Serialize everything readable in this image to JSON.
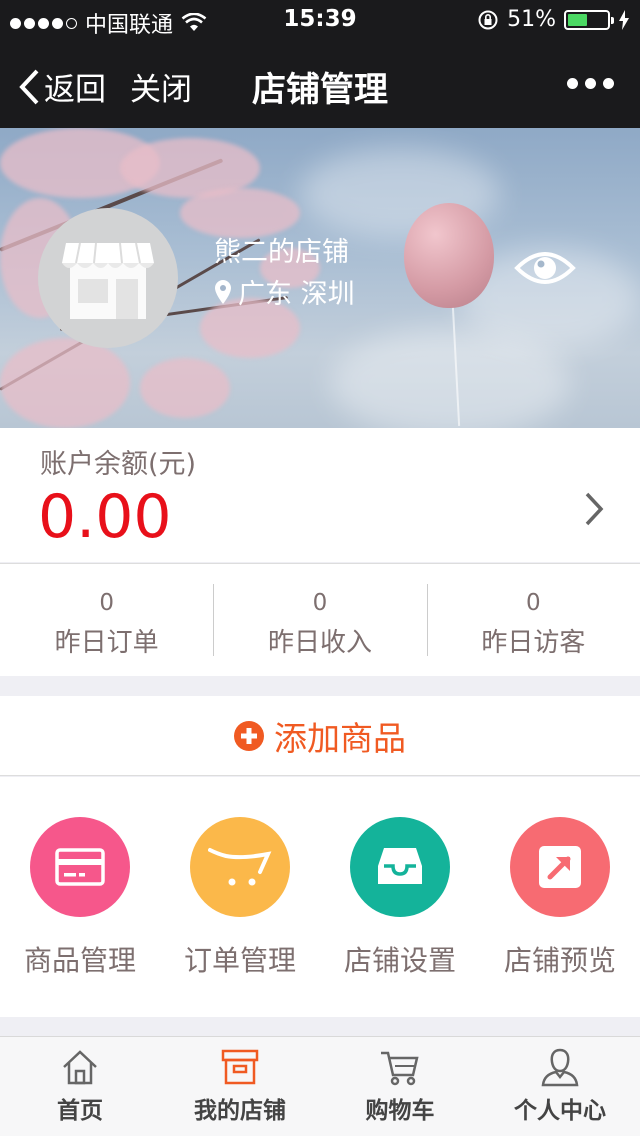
{
  "status_bar": {
    "carrier": "中国联通",
    "time": "15:39",
    "battery_percent": "51%",
    "battery_level": 0.51
  },
  "nav": {
    "back_label": "返回",
    "close_label": "关闭",
    "title": "店铺管理"
  },
  "shop": {
    "name": "熊二的店铺",
    "location": "广东 深圳"
  },
  "balance": {
    "label": "账户余额(元)",
    "value": "0.00"
  },
  "stats": [
    {
      "value": "0",
      "label": "昨日订单"
    },
    {
      "value": "0",
      "label": "昨日收入"
    },
    {
      "value": "0",
      "label": "昨日访客"
    }
  ],
  "add_product": {
    "label": "添加商品",
    "color": "#f05a22"
  },
  "menu": [
    {
      "label": "商品管理",
      "icon": "card-icon",
      "color": "#f6578b"
    },
    {
      "label": "订单管理",
      "icon": "cart-icon",
      "color": "#fbb84a"
    },
    {
      "label": "店铺设置",
      "icon": "inbox-icon",
      "color": "#14b39a"
    },
    {
      "label": "店铺预览",
      "icon": "share-arrow-icon",
      "color": "#f76b72"
    }
  ],
  "tabs": [
    {
      "label": "首页",
      "icon": "home-icon"
    },
    {
      "label": "我的店铺",
      "icon": "store-icon",
      "active": true
    },
    {
      "label": "购物车",
      "icon": "cart-icon"
    },
    {
      "label": "个人中心",
      "icon": "user-icon"
    }
  ]
}
